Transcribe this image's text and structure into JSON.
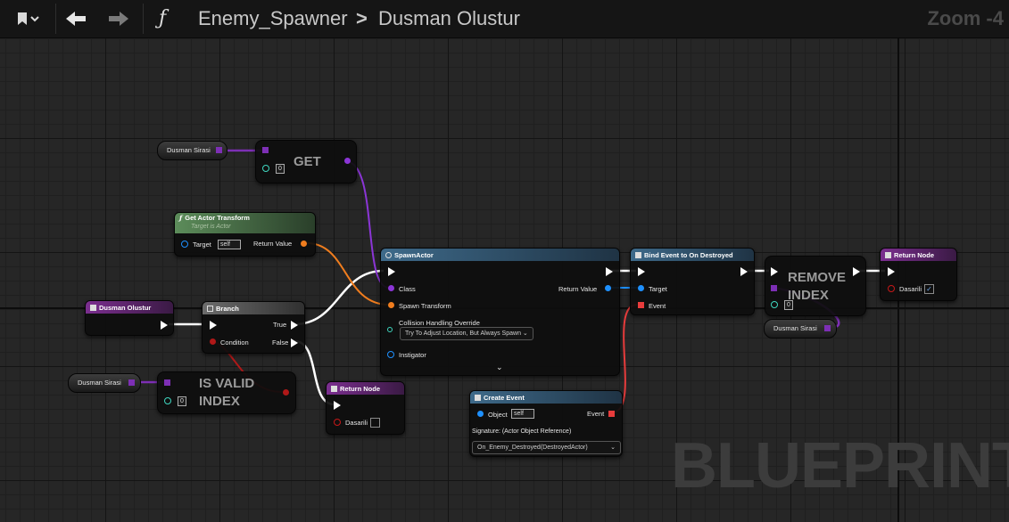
{
  "toolbar": {
    "bookmark_icon": "bookmark-icon",
    "back_icon": "arrow-left-icon",
    "forward_icon": "arrow-right-icon",
    "function_glyph": "ƒ",
    "breadcrumb_parent": "Enemy_Spawner",
    "breadcrumb_separator": ">",
    "breadcrumb_current": "Dusman Olustur",
    "zoom_label": "Zoom -4"
  },
  "watermark": "BLUEPRINT",
  "nodes": {
    "get": {
      "title": "GET",
      "index": "0"
    },
    "get_actor_transform": {
      "title": "Get Actor Transform",
      "subtitle": "Target is Actor",
      "target_label": "Target",
      "target_value": "self",
      "return_label": "Return Value"
    },
    "function_entry": {
      "title": "Dusman Olustur"
    },
    "branch": {
      "title": "Branch",
      "condition_label": "Condition",
      "true_label": "True",
      "false_label": "False"
    },
    "spawn_actor": {
      "title": "SpawnActor",
      "class_label": "Class",
      "spawn_transform_label": "Spawn Transform",
      "collision_label": "Collision Handling Override",
      "collision_value": "Try To Adjust Location, But Always Spawn",
      "instigator_label": "Instigator",
      "return_label": "Return Value"
    },
    "bind_event": {
      "title": "Bind Event to On Destroyed",
      "target_label": "Target",
      "event_label": "Event"
    },
    "remove_index": {
      "title_line1": "REMOVE",
      "title_line2": "INDEX",
      "index": "0"
    },
    "return_node_top": {
      "title": "Return Node",
      "output_label": "Dasarili",
      "checked_mark": "✓"
    },
    "is_valid_index": {
      "title_line1": "IS VALID",
      "title_line2": "INDEX",
      "index": "0"
    },
    "return_node_bottom": {
      "title": "Return Node",
      "output_label": "Dasarili"
    },
    "create_event": {
      "title": "Create Event",
      "object_label": "Object",
      "object_value": "self",
      "event_label": "Event",
      "signature": "Signature: (Actor Object Reference)",
      "function_value": "On_Enemy_Destroyed(DestroyedActor)"
    }
  },
  "variables": {
    "var1": "Dusman Sirasi",
    "var2": "Dusman Sirasi",
    "var3": "Dusman Sirasi"
  },
  "colors": {
    "exec": "#ffffff",
    "object_pin": "#1e90ff",
    "class_pin": "#8b35d6",
    "struct_pin": "#f07d1e",
    "bool_pin": "#b01818",
    "array_pin": "#7d2fb5",
    "int_pin": "#3fd7c0",
    "delegate_pin": "#e83c3c"
  }
}
